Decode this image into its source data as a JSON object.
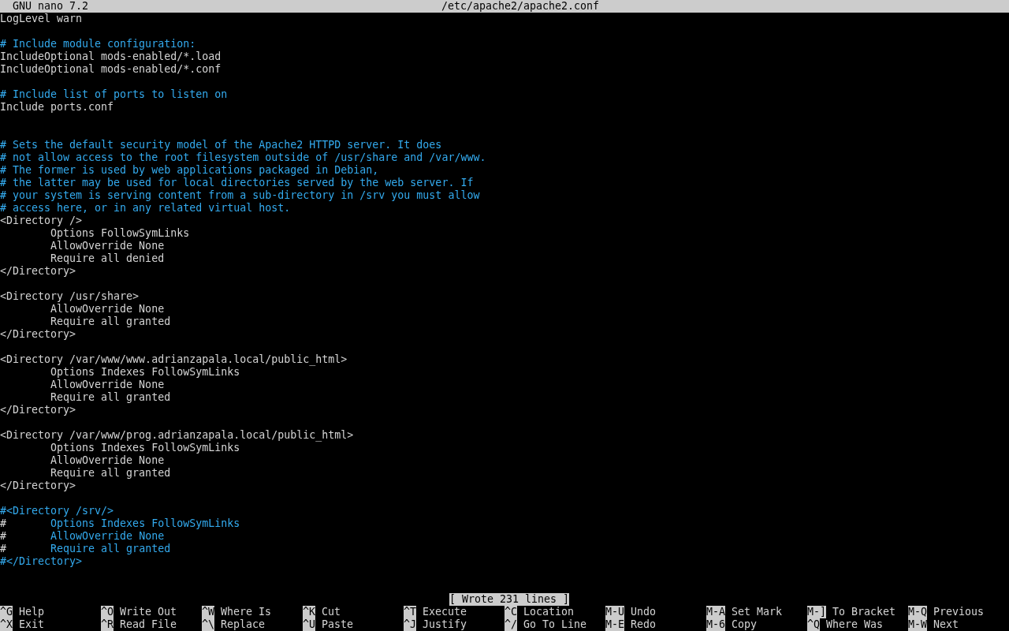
{
  "title_bar": {
    "app": "GNU nano 7.2",
    "file": "/etc/apache2/apache2.conf"
  },
  "lines": [
    {
      "kind": "code",
      "text": "LogLevel warn"
    },
    {
      "kind": "blank"
    },
    {
      "kind": "comment",
      "text": "# Include module configuration:"
    },
    {
      "kind": "code",
      "text": "IncludeOptional mods-enabled/*.load"
    },
    {
      "kind": "code",
      "text": "IncludeOptional mods-enabled/*.conf"
    },
    {
      "kind": "blank"
    },
    {
      "kind": "comment",
      "text": "# Include list of ports to listen on"
    },
    {
      "kind": "code",
      "text": "Include ports.conf"
    },
    {
      "kind": "blank"
    },
    {
      "kind": "blank"
    },
    {
      "kind": "comment",
      "text": "# Sets the default security model of the Apache2 HTTPD server. It does"
    },
    {
      "kind": "comment",
      "text": "# not allow access to the root filesystem outside of /usr/share and /var/www."
    },
    {
      "kind": "comment",
      "text": "# The former is used by web applications packaged in Debian,"
    },
    {
      "kind": "comment",
      "text": "# the latter may be used for local directories served by the web server. If"
    },
    {
      "kind": "comment",
      "text": "# your system is serving content from a sub-directory in /srv you must allow"
    },
    {
      "kind": "comment",
      "text": "# access here, or in any related virtual host."
    },
    {
      "kind": "code",
      "text": "<Directory />"
    },
    {
      "kind": "code",
      "text": "        Options FollowSymLinks"
    },
    {
      "kind": "code",
      "text": "        AllowOverride None"
    },
    {
      "kind": "code",
      "text": "        Require all denied"
    },
    {
      "kind": "code",
      "text": "</Directory>"
    },
    {
      "kind": "blank"
    },
    {
      "kind": "code",
      "text": "<Directory /usr/share>"
    },
    {
      "kind": "code",
      "text": "        AllowOverride None"
    },
    {
      "kind": "code",
      "text": "        Require all granted"
    },
    {
      "kind": "code",
      "text": "</Directory>"
    },
    {
      "kind": "blank"
    },
    {
      "kind": "code",
      "text": "<Directory /var/www/www.adrianzapala.local/public_html>"
    },
    {
      "kind": "code",
      "text": "        Options Indexes FollowSymLinks"
    },
    {
      "kind": "code",
      "text": "        AllowOverride None"
    },
    {
      "kind": "code",
      "text": "        Require all granted"
    },
    {
      "kind": "code",
      "text": "</Directory>"
    },
    {
      "kind": "blank"
    },
    {
      "kind": "code",
      "text": "<Directory /var/www/prog.adrianzapala.local/public_html>"
    },
    {
      "kind": "code",
      "text": "        Options Indexes FollowSymLinks"
    },
    {
      "kind": "code",
      "text": "        AllowOverride None"
    },
    {
      "kind": "code",
      "text": "        Require all granted"
    },
    {
      "kind": "code",
      "text": "</Directory>"
    },
    {
      "kind": "blank"
    },
    {
      "kind": "comment",
      "text": "#<Directory /srv/>"
    },
    {
      "kind": "mixed",
      "parts": [
        {
          "kind": "code",
          "text": "#"
        },
        {
          "kind": "comment",
          "text": "       Options Indexes FollowSymLinks"
        }
      ]
    },
    {
      "kind": "mixed",
      "parts": [
        {
          "kind": "code",
          "text": "#"
        },
        {
          "kind": "comment",
          "text": "       AllowOverride None"
        }
      ]
    },
    {
      "kind": "mixed",
      "parts": [
        {
          "kind": "code",
          "text": "#"
        },
        {
          "kind": "comment",
          "text": "       Require all granted"
        }
      ]
    },
    {
      "kind": "comment",
      "text": "#</Directory>"
    },
    {
      "kind": "blank"
    },
    {
      "kind": "blank"
    }
  ],
  "status_message": "[ Wrote 231 lines ]",
  "shortcuts": [
    [
      {
        "key": "^G",
        "label": "Help"
      },
      {
        "key": "^O",
        "label": "Write Out"
      },
      {
        "key": "^W",
        "label": "Where Is"
      },
      {
        "key": "^K",
        "label": "Cut"
      },
      {
        "key": "^T",
        "label": "Execute"
      },
      {
        "key": "^C",
        "label": "Location"
      },
      {
        "key": "M-U",
        "label": "Undo"
      },
      {
        "key": "M-A",
        "label": "Set Mark"
      },
      {
        "key": "M-]",
        "label": "To Bracket"
      },
      {
        "key": "M-Q",
        "label": "Previous"
      }
    ],
    [
      {
        "key": "^X",
        "label": "Exit"
      },
      {
        "key": "^R",
        "label": "Read File"
      },
      {
        "key": "^\\",
        "label": "Replace"
      },
      {
        "key": "^U",
        "label": "Paste"
      },
      {
        "key": "^J",
        "label": "Justify"
      },
      {
        "key": "^/",
        "label": "Go To Line"
      },
      {
        "key": "M-E",
        "label": "Redo"
      },
      {
        "key": "M-6",
        "label": "Copy"
      },
      {
        "key": "^Q",
        "label": "Where Was"
      },
      {
        "key": "M-W",
        "label": "Next"
      }
    ]
  ]
}
